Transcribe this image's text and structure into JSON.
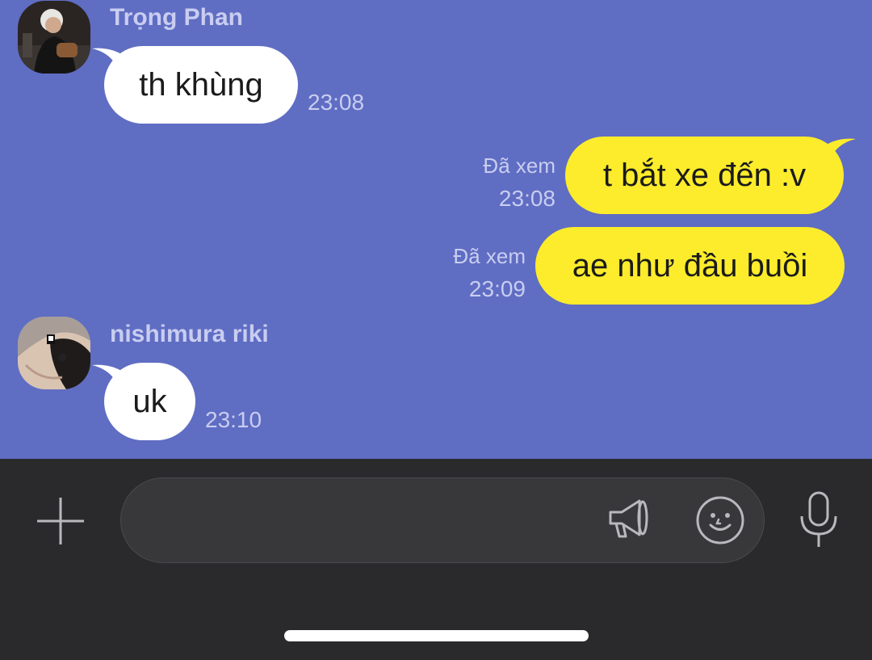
{
  "messages": [
    {
      "sender": "Trọng Phan",
      "text": "th khùng",
      "time": "23:08",
      "direction": "incoming",
      "avatar": "avatar-trong-phan"
    },
    {
      "text": "t bắt xe đến :v",
      "status": "Đã xem",
      "time": "23:08",
      "direction": "outgoing"
    },
    {
      "text": "ae như đầu buồi",
      "status": "Đã xem",
      "time": "23:09",
      "direction": "outgoing"
    },
    {
      "sender": "nishimura riki",
      "text": "uk",
      "time": "23:10",
      "direction": "incoming",
      "avatar": "avatar-nishimura-riki"
    }
  ],
  "composer": {
    "placeholder": "",
    "icons": [
      "plus-icon",
      "megaphone-icon",
      "emoji-icon",
      "microphone-icon"
    ]
  },
  "colors": {
    "chat_background": "#5f6dc3",
    "incoming_bubble": "#ffffff",
    "outgoing_bubble": "#fcec2b",
    "meta_text": "#c9cdf0",
    "input_bar": "#2a2a2c"
  }
}
